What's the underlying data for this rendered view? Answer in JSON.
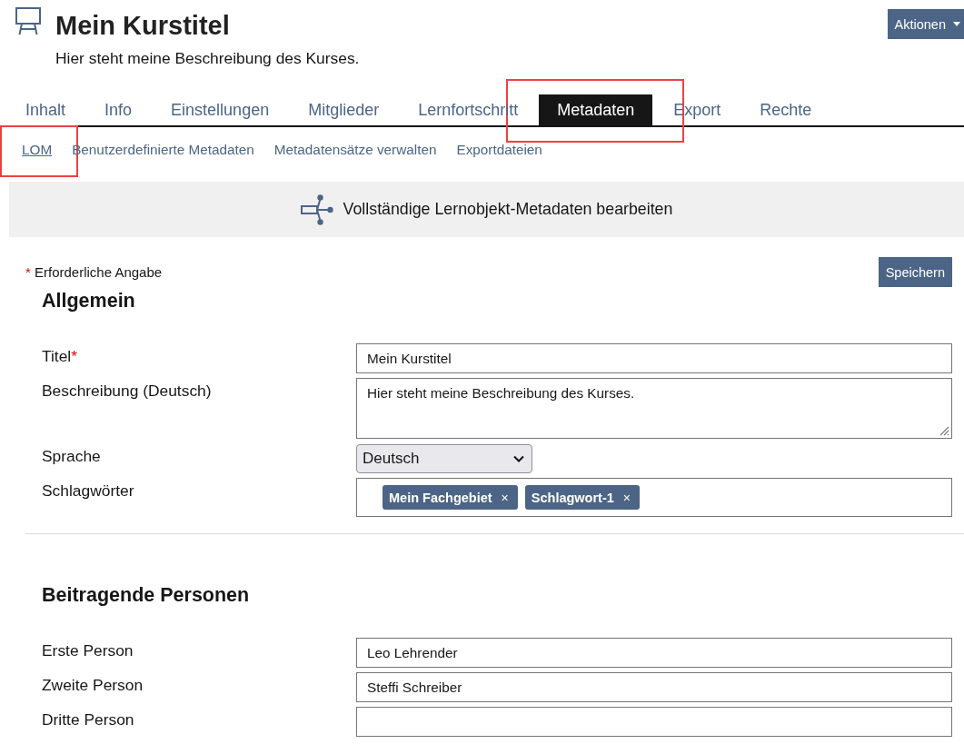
{
  "header": {
    "title": "Mein Kurstitel",
    "description": "Hier steht meine Beschreibung des Kurses.",
    "actions_button": "Aktionen"
  },
  "tabs": [
    {
      "label": "Inhalt",
      "selected": false,
      "highlighted": false
    },
    {
      "label": "Info",
      "selected": false,
      "highlighted": false
    },
    {
      "label": "Einstellungen",
      "selected": false,
      "highlighted": false
    },
    {
      "label": "Mitglieder",
      "selected": false,
      "highlighted": false
    },
    {
      "label": "Lernfortschritt",
      "selected": false,
      "highlighted": false
    },
    {
      "label": "Metadaten",
      "selected": true,
      "highlighted": true
    },
    {
      "label": "Export",
      "selected": false,
      "highlighted": false
    },
    {
      "label": "Rechte",
      "selected": false,
      "highlighted": false
    }
  ],
  "subtabs": [
    {
      "label": "LOM",
      "selected": true,
      "highlighted": true
    },
    {
      "label": "Benutzerdefinierte Metadaten",
      "selected": false,
      "highlighted": false
    },
    {
      "label": "Metadatensätze verwalten",
      "selected": false,
      "highlighted": false
    },
    {
      "label": "Exportdateien",
      "selected": false,
      "highlighted": false
    }
  ],
  "banner": {
    "text": "Vollständige Lernobjekt-Metadaten bearbeiten"
  },
  "form": {
    "required_mark": "*",
    "required_note": "Erforderliche Angabe",
    "save_button": "Speichern",
    "sections": [
      {
        "title": "Allgemein",
        "fields": [
          {
            "kind": "text",
            "label": "Titel",
            "required": true,
            "value": "Mein Kurstitel"
          },
          {
            "kind": "textarea",
            "label": "Beschreibung (Deutsch)",
            "required": false,
            "value": "Hier steht meine Beschreibung des Kurses."
          },
          {
            "kind": "select",
            "label": "Sprache",
            "required": false,
            "value": "Deutsch"
          },
          {
            "kind": "tags",
            "label": "Schlagwörter",
            "required": false,
            "tags": [
              {
                "label": "Mein Fachgebiet",
                "remove": "×"
              },
              {
                "label": "Schlagwort-1",
                "remove": "×"
              }
            ]
          }
        ]
      },
      {
        "title": "Beitragende Personen",
        "fields": [
          {
            "kind": "text",
            "label": "Erste Person",
            "required": false,
            "value": "Leo Lehrender"
          },
          {
            "kind": "text",
            "label": "Zweite Person",
            "required": false,
            "value": "Steffi Schreiber"
          },
          {
            "kind": "text",
            "label": "Dritte Person",
            "required": false
          }
        ]
      }
    ]
  }
}
